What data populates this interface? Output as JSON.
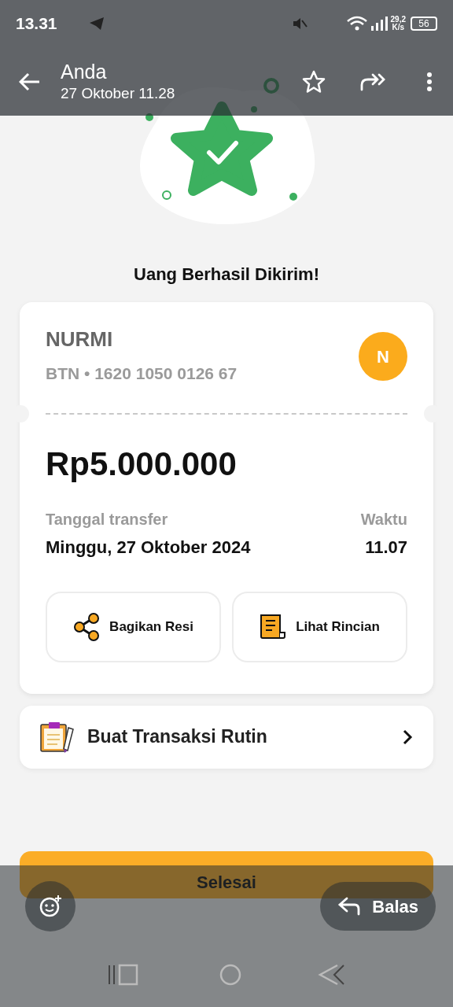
{
  "status_bar": {
    "time": "13.31",
    "speed_value": "29,2",
    "speed_unit": "K/s",
    "battery": "56"
  },
  "header": {
    "title": "Anda",
    "subtitle": "27 Oktober 11.28"
  },
  "receipt": {
    "heading": "Uang Berhasil Dikirim!",
    "recipient_name": "NURMI",
    "account": "BTN • 1620 1050 0126 67",
    "avatar_letter": "N",
    "amount": "Rp5.000.000",
    "date_label": "Tanggal transfer",
    "date": "Minggu, 27 Oktober 2024",
    "time_label": "Waktu",
    "time": "11.07"
  },
  "actions": [
    {
      "kind": "share",
      "label": "Bagikan Resi"
    },
    {
      "kind": "receipt",
      "label": "Lihat Rincian"
    }
  ],
  "routine": {
    "label": "Buat Transaksi Rutin"
  },
  "done_button": {
    "label": "Selesai"
  },
  "reply": {
    "label": "Balas"
  }
}
